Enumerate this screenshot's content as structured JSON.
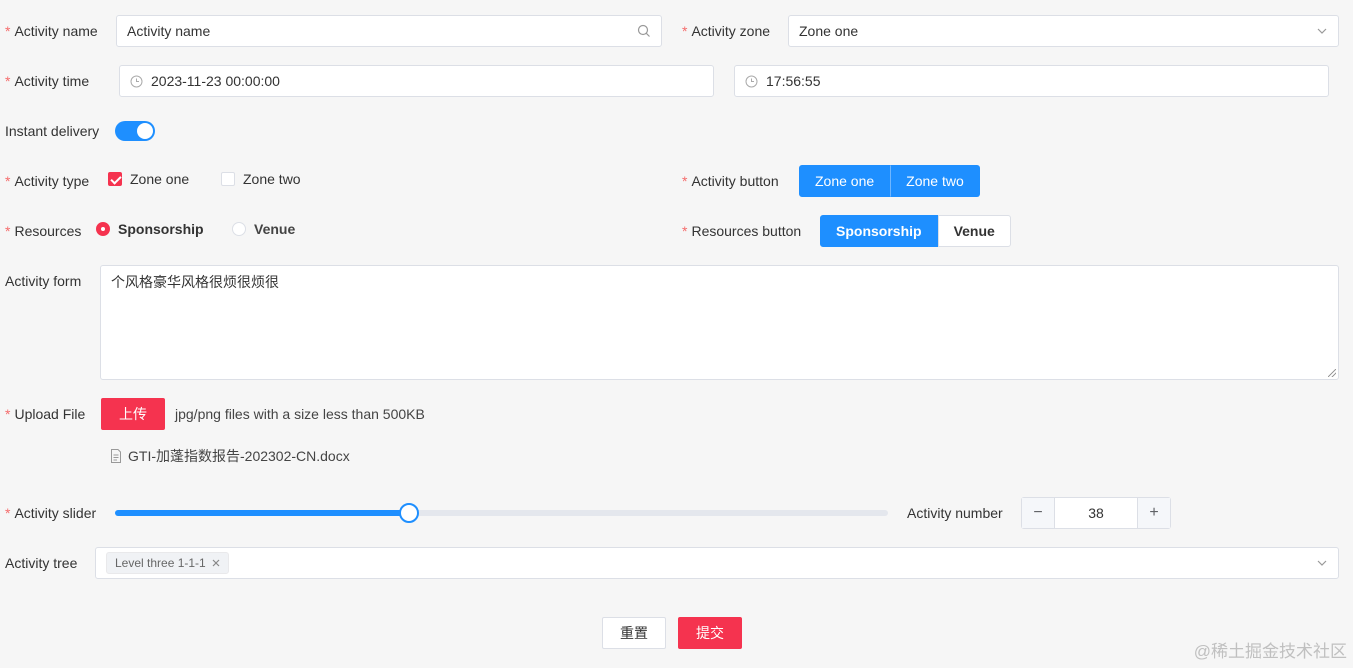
{
  "form": {
    "activity_name": {
      "label": "Activity name",
      "placeholder": "Activity name"
    },
    "activity_zone": {
      "label": "Activity zone",
      "value": "Zone one"
    },
    "activity_time": {
      "label": "Activity time",
      "date": "2023-11-23 00:00:00",
      "time": "17:56:55"
    },
    "instant_delivery": {
      "label": "Instant delivery",
      "on": true
    },
    "activity_type": {
      "label": "Activity type",
      "options": [
        {
          "label": "Zone one",
          "checked": true
        },
        {
          "label": "Zone two",
          "checked": false
        }
      ]
    },
    "activity_button": {
      "label": "Activity button",
      "options": [
        "Zone one",
        "Zone two"
      ]
    },
    "resources": {
      "label": "Resources",
      "options": [
        {
          "label": "Sponsorship",
          "selected": true
        },
        {
          "label": "Venue",
          "selected": false
        }
      ]
    },
    "resources_button": {
      "label": "Resources button",
      "options": [
        "Sponsorship",
        "Venue"
      ],
      "selected": "Sponsorship"
    },
    "activity_form": {
      "label": "Activity form",
      "value": "个风格豪华风格很烦很烦很"
    },
    "upload_file": {
      "label": "Upload File",
      "button": "上传",
      "hint": "jpg/png files with a size less than 500KB",
      "file": "GTI-加蓬指数报告-202302-CN.docx"
    },
    "activity_slider": {
      "label": "Activity slider",
      "value_fraction": 0.38
    },
    "activity_number": {
      "label": "Activity number",
      "value": "38",
      "minus": "−",
      "plus": "+"
    },
    "activity_tree": {
      "label": "Activity tree",
      "tag": "Level three 1-1-1"
    }
  },
  "actions": {
    "reset": "重置",
    "submit": "提交"
  },
  "watermark": "@稀土掘金技术社区",
  "colors": {
    "primary": "#1e8fff",
    "danger": "#f5334f",
    "required": "#f56c6c"
  },
  "icons": [
    "search-icon",
    "chevron-down-icon",
    "clock-icon",
    "document-icon",
    "close-icon"
  ]
}
